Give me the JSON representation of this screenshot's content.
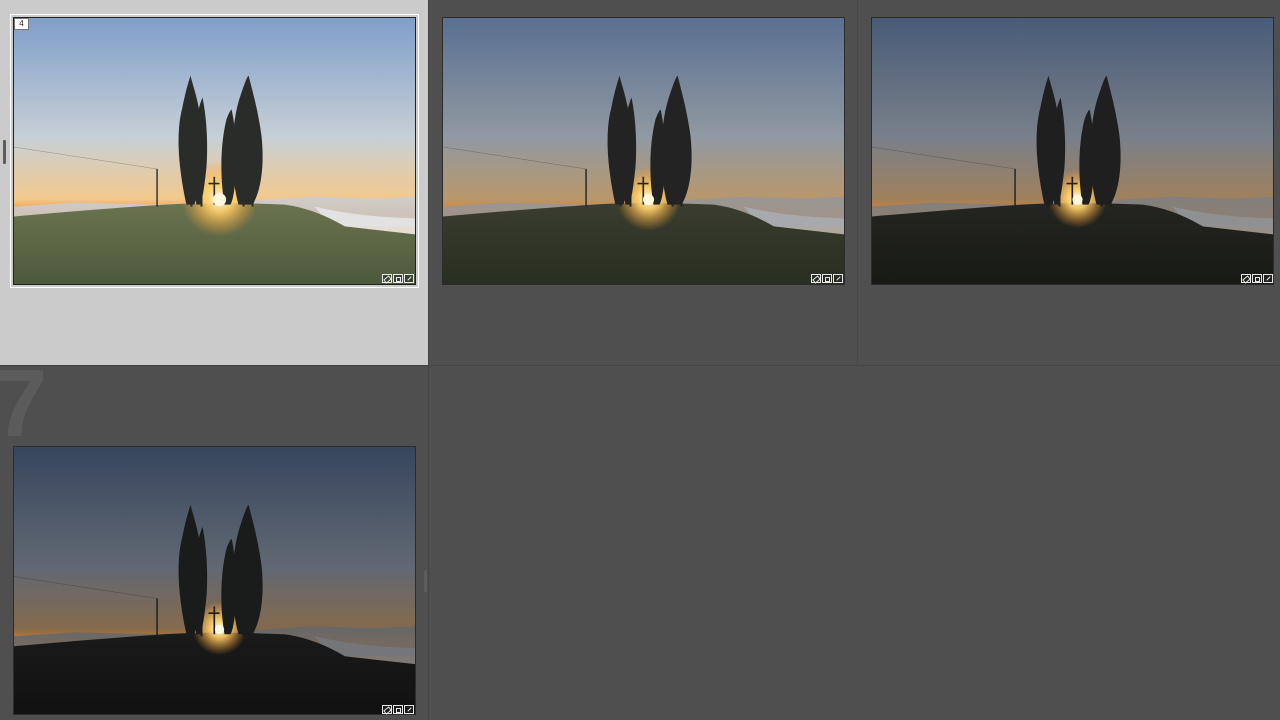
{
  "grid": {
    "cells": [
      {
        "index": "",
        "badge": "4",
        "selected": true,
        "exposure": 1.0
      },
      {
        "index": "",
        "badge": "",
        "selected": false,
        "exposure": 0.62
      },
      {
        "index": "",
        "badge": "",
        "selected": false,
        "exposure": 0.45
      },
      {
        "index": "7",
        "badge": "",
        "selected": false,
        "exposure": 0.28
      }
    ]
  },
  "colors": {
    "background": "#4f4f4f",
    "selected_cell": "#cbcbcb",
    "selection_outline": "#ffffff"
  },
  "icons": [
    "tag-icon",
    "crop-icon",
    "quick-develop-icon"
  ]
}
